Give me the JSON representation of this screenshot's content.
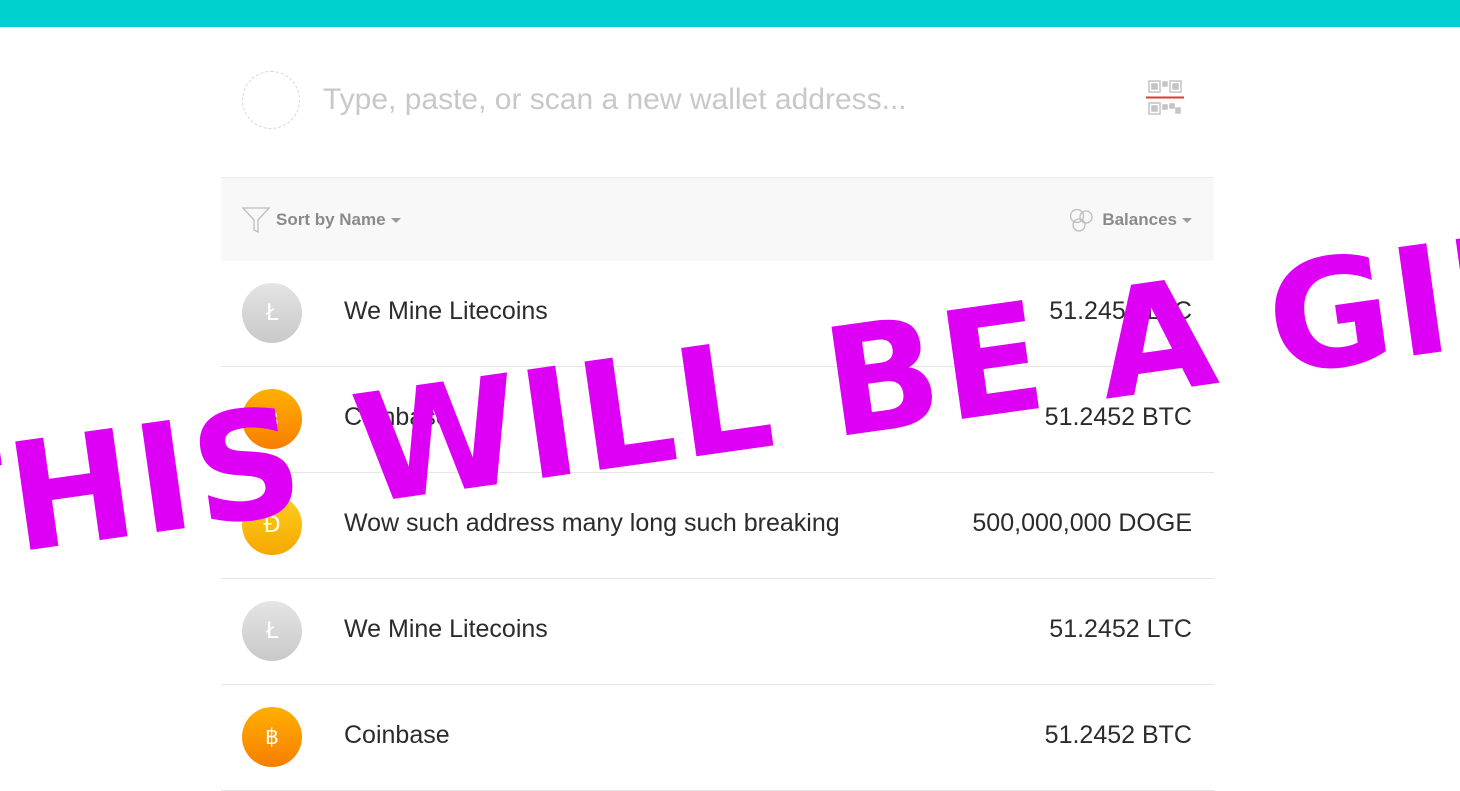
{
  "colors": {
    "topbar": "#00cfd0",
    "overlay_text": "#dd00f5",
    "ltc": "#c9c9c9",
    "btc": "#f77e00",
    "doge": "#ffc107"
  },
  "search": {
    "placeholder": "Type, paste, or scan a new wallet address...",
    "value": "",
    "qr_icon": "qr-scan-icon"
  },
  "toolbar": {
    "sort_icon": "funnel-icon",
    "sort_label": "Sort by Name",
    "balances_icon": "coins-icon",
    "balances_label": "Balances"
  },
  "wallets": [
    {
      "name": "We Mine Litecoins",
      "balance": "51.2452 LTC",
      "coin": "LTC",
      "symbol": "Ł"
    },
    {
      "name": "Coinbase",
      "balance": "51.2452 BTC",
      "coin": "BTC",
      "symbol": "฿"
    },
    {
      "name": "Wow such address many long such breaking",
      "balance": "500,000,000 DOGE",
      "coin": "DOGE",
      "symbol": "Đ"
    },
    {
      "name": "We Mine Litecoins",
      "balance": "51.2452 LTC",
      "coin": "LTC",
      "symbol": "Ł"
    },
    {
      "name": "Coinbase",
      "balance": "51.2452 BTC",
      "coin": "BTC",
      "symbol": "฿"
    }
  ],
  "overlay": {
    "text": "THIS WILL BE A GIF"
  }
}
